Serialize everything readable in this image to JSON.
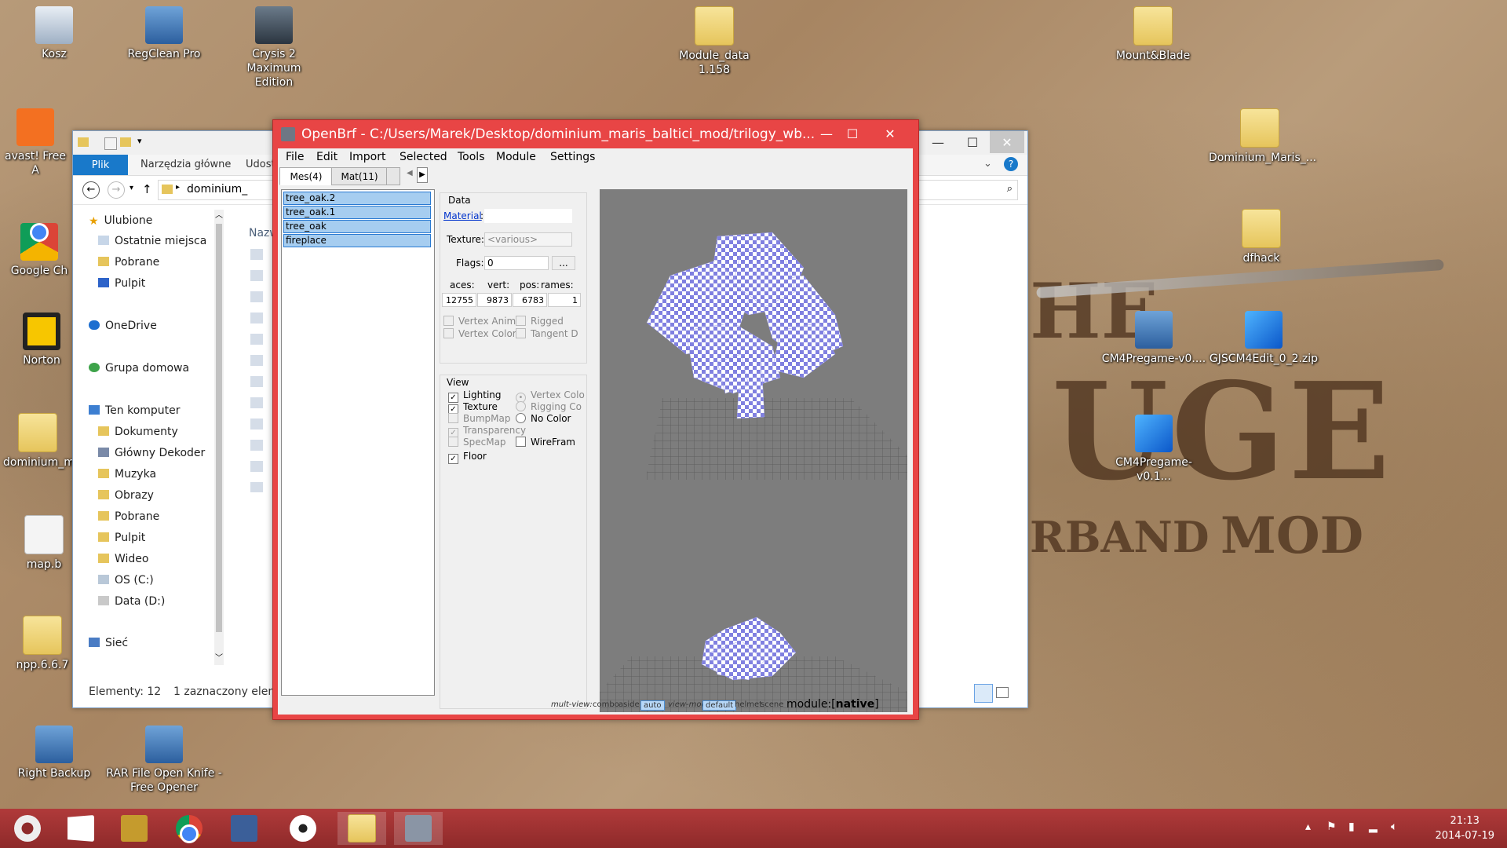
{
  "desktop": {
    "icons": [
      {
        "label": "Kosz",
        "icon": "recycle-bin-icon"
      },
      {
        "label": "RegClean Pro",
        "icon": "regclean-icon"
      },
      {
        "label": "Crysis 2 Maximum Edition",
        "icon": "crysis-icon"
      },
      {
        "label": "Module_data 1.158",
        "icon": "folder-icon"
      },
      {
        "label": "Mount&Blade",
        "icon": "folder-icon"
      },
      {
        "label": "avast! Free A",
        "icon": "avast-icon"
      },
      {
        "label": "Google Ch",
        "icon": "chrome-icon"
      },
      {
        "label": "Norton",
        "icon": "norton-icon"
      },
      {
        "label": "dominium_m",
        "icon": "folder-icon"
      },
      {
        "label": "map.b",
        "icon": "file-icon"
      },
      {
        "label": "npp.6.6.7",
        "icon": "folder-icon"
      },
      {
        "label": "Right Backup",
        "icon": "backup-icon"
      },
      {
        "label": "RAR File Open Knife - Free Opener",
        "icon": "rar-icon"
      },
      {
        "label": "Dominium_Maris_...",
        "icon": "folder-icon"
      },
      {
        "label": "dfhack",
        "icon": "folder-icon"
      },
      {
        "label": "CM4Pregame-v0....",
        "icon": "installer-icon"
      },
      {
        "label": "GJSCM4Edit_0_2.zip",
        "icon": "cube-icon"
      },
      {
        "label": "CM4Pregame-v0.1...",
        "icon": "cube-icon"
      }
    ]
  },
  "explorer": {
    "ribbon": {
      "file_tab": "Plik",
      "home_tab": "Narzędzia główne",
      "share_tab": "Udost"
    },
    "address": {
      "path": "dominium_"
    },
    "column_header": "Nazw",
    "nav": {
      "favorites": "Ulubione",
      "recent": "Ostatnie miejsca",
      "downloads": "Pobrane",
      "desktop": "Pulpit",
      "onedrive": "OneDrive",
      "homegroup": "Grupa domowa",
      "this_pc": "Ten komputer",
      "documents": "Dokumenty",
      "glowny": "Główny Dekoder",
      "music": "Muzyka",
      "pictures": "Obrazy",
      "downloads2": "Pobrane",
      "desktop2": "Pulpit",
      "videos": "Wideo",
      "os_c": "OS (C:)",
      "data_d": "Data (D:)",
      "network": "Sieć"
    },
    "status": {
      "items": "Elementy: 12",
      "selected": "1 zaznaczony elem"
    },
    "search_placeholder": "r"
  },
  "openbrf": {
    "title": "OpenBrf - C:/Users/Marek/Desktop/dominium_maris_baltici_mod/trilogy_wb...",
    "menu": [
      "File",
      "Edit",
      "Import",
      "Selected",
      "Tools",
      "Module",
      "Settings"
    ],
    "tabs": [
      "Mes(4)",
      "Mat(11)"
    ],
    "meshes": [
      "tree_oak.2",
      "tree_oak.1",
      "tree_oak",
      "fireplace"
    ],
    "data": {
      "group_label": "Data",
      "material_label": "Material",
      "material_value": "",
      "texture_label": "Texture:",
      "texture_value": "<various>",
      "flags_label": "Flags:",
      "flags_value": "0",
      "flags_button": "...",
      "faces_label": "aces:",
      "vert_label": "vert:",
      "pos_label": "pos:",
      "frames_label": "rames:",
      "faces_value": "12755",
      "vert_value": "9873",
      "pos_value": "6783",
      "frames_value": "1",
      "vertex_anim": "Vertex Anim",
      "rigged": "Rigged",
      "vertex_color": "Vertex Color",
      "tangent": "Tangent D"
    },
    "view": {
      "group_label": "View",
      "lighting": "Lighting",
      "texture": "Texture",
      "bumpmap": "BumpMap",
      "transparency": "Transparency",
      "specmap": "SpecMap",
      "floor": "Floor",
      "vertex_color": "Vertex Colo",
      "rigging": "Rigging Co",
      "no_color": "No Color",
      "wireframe": "WireFram"
    },
    "status": {
      "multiview_label": "mult-view:",
      "combo": "combo",
      "aside": "aside",
      "auto": "auto",
      "viewmode_label": "view-mode:",
      "default": "default",
      "helmet": "helmet",
      "scene": "scene",
      "module_label": "module:[",
      "module_value": "native",
      "module_close": "]"
    }
  },
  "taskbar": {
    "clock_time": "21:13",
    "clock_date": "2014-07-19"
  },
  "wallpaper": {
    "text_he": "HE",
    "text_uge": "UGE",
    "text_rband": "RBAND",
    "text_mod": "MOD"
  }
}
